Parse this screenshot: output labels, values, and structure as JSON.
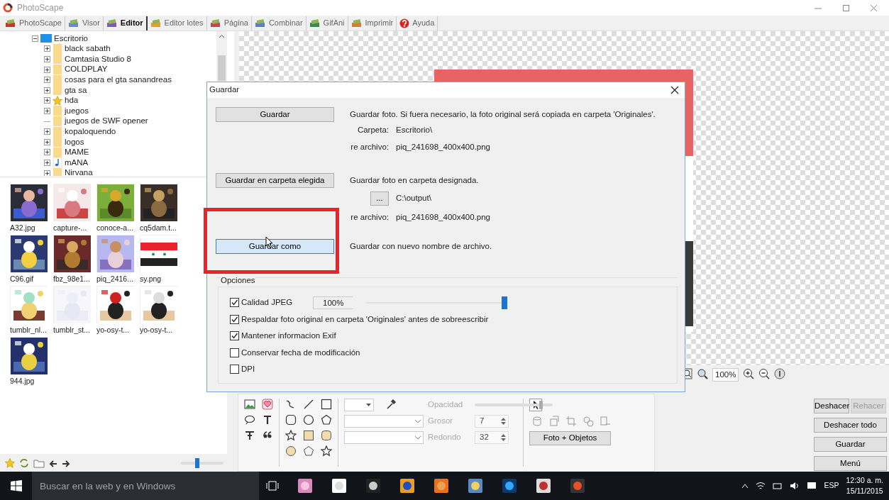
{
  "window": {
    "title": "PhotoScape"
  },
  "tabs": [
    {
      "label": "PhotoScape",
      "selected": false
    },
    {
      "label": "Visor",
      "selected": false
    },
    {
      "label": "Editor",
      "selected": true
    },
    {
      "label": "Editor lotes",
      "selected": false
    },
    {
      "label": "Página",
      "selected": false
    },
    {
      "label": "Combinar",
      "selected": false
    },
    {
      "label": "GifAni",
      "selected": false
    },
    {
      "label": "Imprimir",
      "selected": false
    },
    {
      "label": "Ayuda",
      "selected": false
    }
  ],
  "folder_tree": {
    "label": "Escritorio",
    "expanded": true,
    "children": [
      {
        "label": "black sabath",
        "kind": "folder",
        "expandable": true
      },
      {
        "label": "Camtasia Studio 8",
        "kind": "folder",
        "expandable": true
      },
      {
        "label": "COLDPLAY",
        "kind": "folder",
        "expandable": true
      },
      {
        "label": "cosas para el gta sanandreas",
        "kind": "folder",
        "expandable": true
      },
      {
        "label": "gta sa",
        "kind": "folder",
        "expandable": true
      },
      {
        "label": "hda",
        "kind": "star",
        "expandable": true
      },
      {
        "label": "juegos",
        "kind": "folder",
        "expandable": true
      },
      {
        "label": "juegos de SWF opener",
        "kind": "folder",
        "expandable": false
      },
      {
        "label": "kopaloquendo",
        "kind": "folder",
        "expandable": true
      },
      {
        "label": "logos",
        "kind": "folder",
        "expandable": true
      },
      {
        "label": "MAME",
        "kind": "folder",
        "expandable": true
      },
      {
        "label": "mANA",
        "kind": "music",
        "expandable": true
      },
      {
        "label": "Nirvana",
        "kind": "folder",
        "expandable": true
      }
    ]
  },
  "thumbnails": [
    {
      "label": "A32.jpg"
    },
    {
      "label": "capture-..."
    },
    {
      "label": "conoce-a..."
    },
    {
      "label": "cq5dam.t..."
    },
    {
      "label": "C96.gif"
    },
    {
      "label": "fbz_98e1..."
    },
    {
      "label": "piq_2416..."
    },
    {
      "label": "sy.png"
    },
    {
      "label": "tumblr_nl..."
    },
    {
      "label": "tumblr_st..."
    },
    {
      "label": "yo-osy-t..."
    },
    {
      "label": "yo-osy-t..."
    },
    {
      "label": "944.jpg"
    }
  ],
  "thumb_size": {
    "level": 0.38
  },
  "dialog": {
    "title": "Guardar",
    "actions": [
      {
        "button": "Guardar",
        "hovered": false,
        "description": "Guardar foto. Si fuera necesario, la foto original será copiada en carpeta 'Originales'.",
        "details": [
          {
            "label": "Carpeta:",
            "value": "Escritorio\\"
          },
          {
            "label": "re archivo:",
            "value": "piq_241698_400x400.png"
          }
        ]
      },
      {
        "button": "Guardar en carpeta elegida",
        "hovered": false,
        "description": "Guardar foto en carpeta designada.",
        "details": [
          {
            "browse": "...",
            "value": "C:\\output\\"
          },
          {
            "label": "re archivo:",
            "value": "piq_241698_400x400.png"
          }
        ]
      },
      {
        "button": "Guardar como",
        "hovered": true,
        "description": "Guardar con nuevo nombre de archivo."
      }
    ],
    "options": {
      "title": "Opciones",
      "items": [
        {
          "label": "Calidad JPEG",
          "checked": true,
          "kind": "quality",
          "value": "100%",
          "level": 1
        },
        {
          "label": "Respaldar foto original en carpeta 'Originales' antes de sobreescribir",
          "checked": true,
          "kind": "check"
        },
        {
          "label": "Mantener informacion Exif",
          "checked": true,
          "kind": "check"
        },
        {
          "label": "Conservar fecha de modificación",
          "checked": false,
          "kind": "check"
        },
        {
          "label": "DPI",
          "checked": false,
          "kind": "check"
        }
      ]
    }
  },
  "zoom_bar": {
    "value": "100%"
  },
  "tool_panel": {
    "fields": [
      {
        "label": "Opacidad",
        "kind": "slider",
        "level": 0.85,
        "disabled": true
      },
      {
        "label": "Grosor",
        "kind": "spin",
        "value": "7",
        "disabled": true
      },
      {
        "label": "Redondo",
        "kind": "spin",
        "value": "32",
        "disabled": true
      }
    ],
    "mode_button": "Foto + Objetos"
  },
  "action_buttons": [
    {
      "label": "Deshacer",
      "disabled": false
    },
    {
      "label": "Rehacer",
      "disabled": true
    },
    {
      "label": "Deshacer todo",
      "disabled": false
    },
    {
      "label": "Guardar",
      "disabled": false
    },
    {
      "label": "Menú",
      "disabled": false
    }
  ],
  "taskbar": {
    "search": {
      "placeholder": "Buscar en la web y en Windows"
    },
    "language": "ESP",
    "time": "12:30 a. m.",
    "date": "15/11/2015"
  }
}
